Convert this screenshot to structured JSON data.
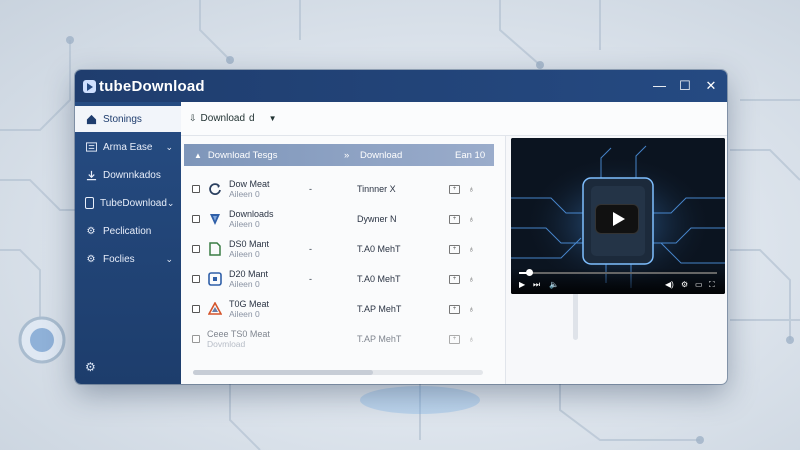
{
  "app": {
    "title": "tubeDownload",
    "window_controls": {
      "minimize": "—",
      "maximize": "☐",
      "close": "✕"
    }
  },
  "sidebar": {
    "items": [
      {
        "label": "Stonings",
        "icon": "home-icon",
        "has_chevron": false,
        "active": true
      },
      {
        "label": "Arma Ease",
        "icon": "list-icon",
        "has_chevron": true,
        "active": false
      },
      {
        "label": "Downnkados",
        "icon": "download-icon",
        "has_chevron": false,
        "active": false
      },
      {
        "label": "TubeDownload",
        "icon": "phone-icon",
        "has_chevron": true,
        "active": false
      },
      {
        "label": "Peclication",
        "icon": "gear-icon",
        "has_chevron": false,
        "active": false
      },
      {
        "label": "Foclies",
        "icon": "cog-icon",
        "has_chevron": true,
        "active": false
      }
    ],
    "bottom_icon": "settings-icon"
  },
  "toolbar": {
    "dropdown_label": "Download",
    "dropdown_value": "d"
  },
  "list": {
    "header": {
      "col1": "Download Tesgs",
      "col3": "Download",
      "col4": "Ean 10"
    },
    "rows": [
      {
        "name": "Dow Meat",
        "sub": "Aileen 0",
        "dash": "-",
        "status": "Tinnner X",
        "icon": "sync-icon",
        "icon_color": "#2a3f5f"
      },
      {
        "name": "Downloads",
        "sub": "Aileen 0",
        "dash": "",
        "status": "Dywner N",
        "icon": "shield-icon",
        "icon_color": "#2f5fa8"
      },
      {
        "name": "DS0 Mant",
        "sub": "Aileen 0",
        "dash": "-",
        "status": "T.A0 MehT",
        "icon": "file-icon",
        "icon_color": "#3a7d44"
      },
      {
        "name": "D20 Mant",
        "sub": "Aileen 0",
        "dash": "-",
        "status": "T.A0 MehT",
        "icon": "box-icon",
        "icon_color": "#2f5fa8"
      },
      {
        "name": "T0G Meat",
        "sub": "Aileen 0",
        "dash": "",
        "status": "T.AP MehT",
        "icon": "triangle-icon",
        "icon_color": "#d4552b"
      },
      {
        "name": "Ceee TS0 Meat",
        "sub": "Dovmload",
        "dash": "",
        "status": "T.AP MehT",
        "icon": "none",
        "icon_color": "#999"
      }
    ]
  },
  "video": {
    "progress": 0.05
  },
  "colors": {
    "titlebar": "#1f3d6e",
    "sidebar": "#264c82",
    "header": "#8aa0c2"
  }
}
